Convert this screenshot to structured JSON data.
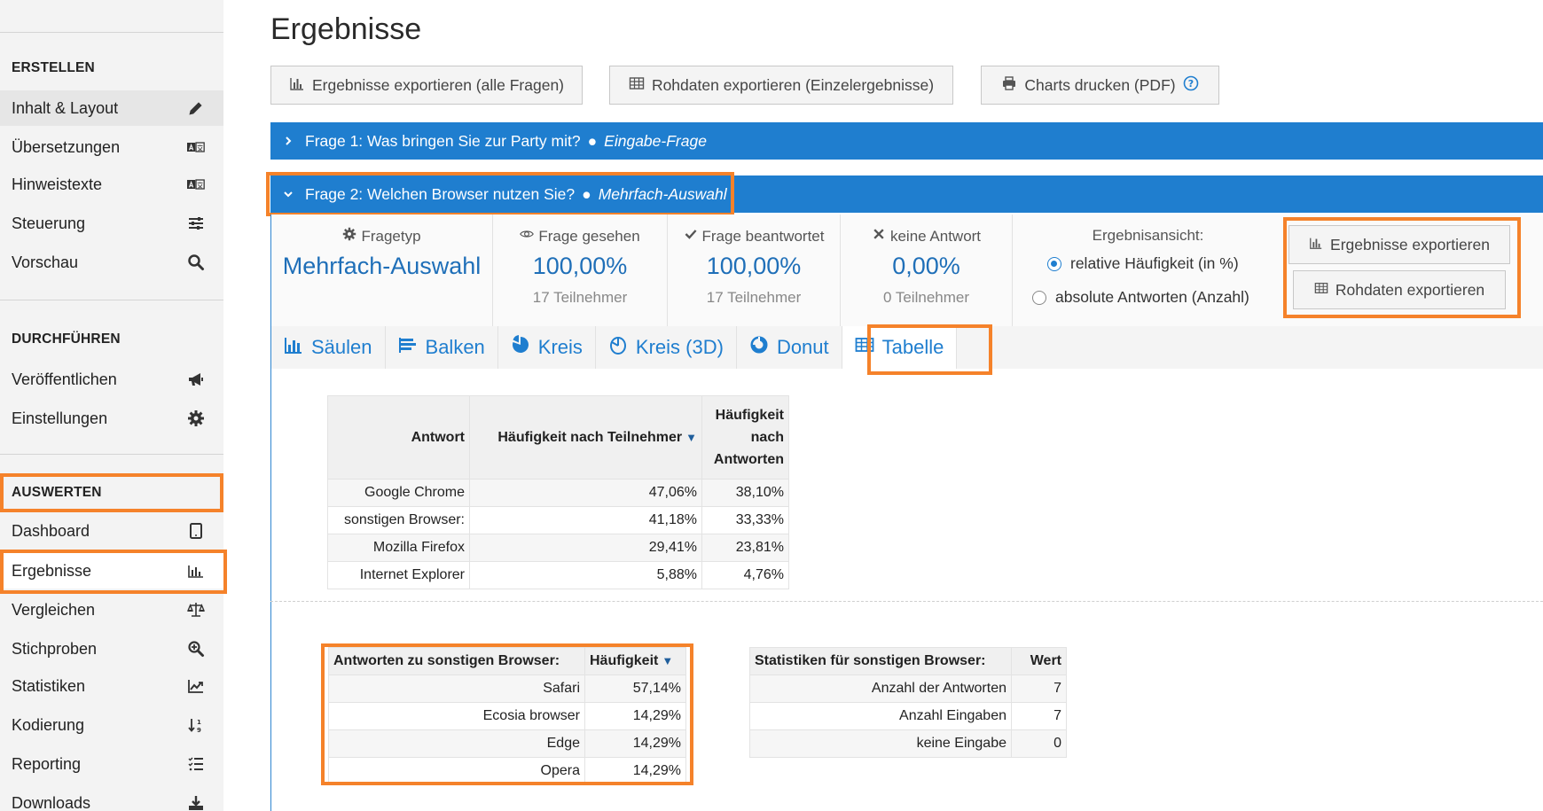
{
  "sidebar": {
    "sections": [
      {
        "heading": "ERSTELLEN",
        "items": [
          {
            "label": "Inhalt & Layout",
            "icon": "pencil-icon"
          },
          {
            "label": "Übersetzungen",
            "icon": "translate-icon"
          },
          {
            "label": "Hinweistexte",
            "icon": "translate-icon"
          },
          {
            "label": "Steuerung",
            "icon": "sliders-icon"
          },
          {
            "label": "Vorschau",
            "icon": "search-icon"
          }
        ]
      },
      {
        "heading": "DURCHFÜHREN",
        "items": [
          {
            "label": "Veröffentlichen",
            "icon": "megaphone-icon"
          },
          {
            "label": "Einstellungen",
            "icon": "gear-icon"
          }
        ]
      },
      {
        "heading": "AUSWERTEN",
        "items": [
          {
            "label": "Dashboard",
            "icon": "tablet-icon"
          },
          {
            "label": "Ergebnisse",
            "icon": "bar-chart-icon"
          },
          {
            "label": "Vergleichen",
            "icon": "balance-scale-icon"
          },
          {
            "label": "Stichproben",
            "icon": "zoom-in-icon"
          },
          {
            "label": "Statistiken",
            "icon": "line-chart-icon"
          },
          {
            "label": "Kodierung",
            "icon": "sort-numeric-icon"
          },
          {
            "label": "Reporting",
            "icon": "list-check-icon"
          },
          {
            "label": "Downloads",
            "icon": "download-icon"
          }
        ]
      }
    ]
  },
  "main": {
    "title": "Ergebnisse",
    "toolbar": {
      "export_all": "Ergebnisse exportieren (alle Fragen)",
      "export_raw": "Rohdaten exportieren (Einzelergebnisse)",
      "print_charts": "Charts drucken (PDF)"
    },
    "questions": [
      {
        "label": "Frage 1: Was bringen Sie zur Party mit?",
        "type": "Eingabe-Frage",
        "expanded": false
      },
      {
        "label": "Frage 2: Welchen Browser nutzen Sie?",
        "type": "Mehrfach-Auswahl",
        "expanded": true
      }
    ],
    "stats": {
      "fragetyp_label": "Fragetyp",
      "fragetyp_value": "Mehrfach-Auswahl",
      "gesehen_label": "Frage gesehen",
      "gesehen_value": "100,00%",
      "gesehen_count": "17 Teilnehmer",
      "beantwortet_label": "Frage beantwortet",
      "beantwortet_value": "100,00%",
      "beantwortet_count": "17 Teilnehmer",
      "keine_label": "keine Antwort",
      "keine_value": "0,00%",
      "keine_count": "0 Teilnehmer",
      "ansicht_label": "Ergebnisansicht:",
      "option_relative": "relative Häufigkeit (in %)",
      "option_absolute": "absolute Antworten (Anzahl)",
      "selected_option": "relative",
      "btn_export": "Ergebnisse exportieren",
      "btn_raw": "Rohdaten exportieren"
    },
    "tabs": [
      {
        "label": "Säulen",
        "icon": "column-chart-icon"
      },
      {
        "label": "Balken",
        "icon": "bar-lines-icon"
      },
      {
        "label": "Kreis",
        "icon": "pie-chart-icon"
      },
      {
        "label": "Kreis (3D)",
        "icon": "pie-3d-icon"
      },
      {
        "label": "Donut",
        "icon": "donut-icon"
      },
      {
        "label": "Tabelle",
        "icon": "table-icon",
        "active": true
      }
    ],
    "results_table": {
      "headers": [
        "Antwort",
        "Häufigkeit nach Teilnehmer",
        "Häufigkeit nach Antworten"
      ],
      "rows": [
        [
          "Google Chrome",
          "47,06%",
          "38,10%"
        ],
        [
          "sonstigen Browser:",
          "41,18%",
          "33,33%"
        ],
        [
          "Mozilla Firefox",
          "29,41%",
          "23,81%"
        ],
        [
          "Internet Explorer",
          "5,88%",
          "4,76%"
        ]
      ]
    },
    "other_answers_table": {
      "headers": [
        "Antworten zu sonstigen Browser:",
        "Häufigkeit"
      ],
      "rows": [
        [
          "Safari",
          "57,14%"
        ],
        [
          "Ecosia browser",
          "14,29%"
        ],
        [
          "Edge",
          "14,29%"
        ],
        [
          "Opera",
          "14,29%"
        ]
      ]
    },
    "other_stats_table": {
      "headers": [
        "Statistiken für sonstigen Browser:",
        "Wert"
      ],
      "rows": [
        [
          "Anzahl der Antworten",
          "7"
        ],
        [
          "Anzahl Eingaben",
          "7"
        ],
        [
          "keine Eingabe",
          "0"
        ]
      ]
    }
  },
  "colors": {
    "accent": "#1f7ecf",
    "highlight": "#f5822a"
  }
}
